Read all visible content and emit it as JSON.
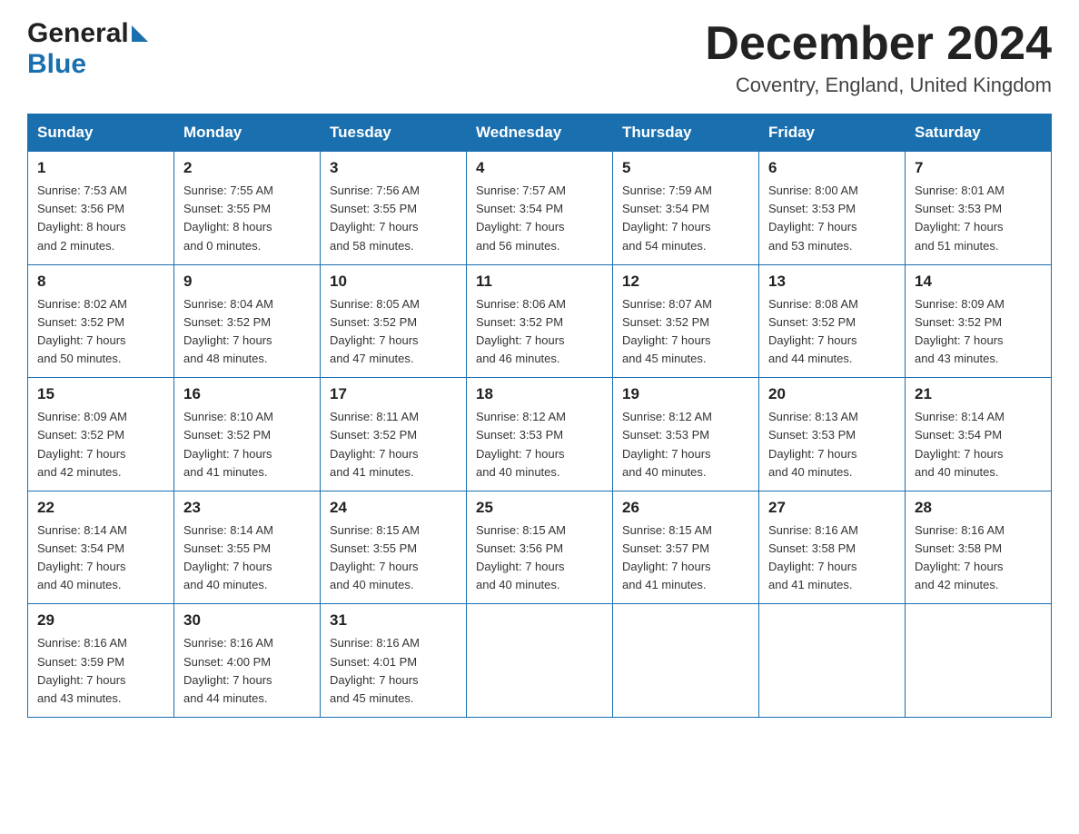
{
  "header": {
    "logo_general": "General",
    "logo_blue": "Blue",
    "title": "December 2024",
    "subtitle": "Coventry, England, United Kingdom"
  },
  "days_of_week": [
    "Sunday",
    "Monday",
    "Tuesday",
    "Wednesday",
    "Thursday",
    "Friday",
    "Saturday"
  ],
  "weeks": [
    [
      {
        "day": "1",
        "sunrise": "7:53 AM",
        "sunset": "3:56 PM",
        "daylight": "8 hours and 2 minutes."
      },
      {
        "day": "2",
        "sunrise": "7:55 AM",
        "sunset": "3:55 PM",
        "daylight": "8 hours and 0 minutes."
      },
      {
        "day": "3",
        "sunrise": "7:56 AM",
        "sunset": "3:55 PM",
        "daylight": "7 hours and 58 minutes."
      },
      {
        "day": "4",
        "sunrise": "7:57 AM",
        "sunset": "3:54 PM",
        "daylight": "7 hours and 56 minutes."
      },
      {
        "day": "5",
        "sunrise": "7:59 AM",
        "sunset": "3:54 PM",
        "daylight": "7 hours and 54 minutes."
      },
      {
        "day": "6",
        "sunrise": "8:00 AM",
        "sunset": "3:53 PM",
        "daylight": "7 hours and 53 minutes."
      },
      {
        "day": "7",
        "sunrise": "8:01 AM",
        "sunset": "3:53 PM",
        "daylight": "7 hours and 51 minutes."
      }
    ],
    [
      {
        "day": "8",
        "sunrise": "8:02 AM",
        "sunset": "3:52 PM",
        "daylight": "7 hours and 50 minutes."
      },
      {
        "day": "9",
        "sunrise": "8:04 AM",
        "sunset": "3:52 PM",
        "daylight": "7 hours and 48 minutes."
      },
      {
        "day": "10",
        "sunrise": "8:05 AM",
        "sunset": "3:52 PM",
        "daylight": "7 hours and 47 minutes."
      },
      {
        "day": "11",
        "sunrise": "8:06 AM",
        "sunset": "3:52 PM",
        "daylight": "7 hours and 46 minutes."
      },
      {
        "day": "12",
        "sunrise": "8:07 AM",
        "sunset": "3:52 PM",
        "daylight": "7 hours and 45 minutes."
      },
      {
        "day": "13",
        "sunrise": "8:08 AM",
        "sunset": "3:52 PM",
        "daylight": "7 hours and 44 minutes."
      },
      {
        "day": "14",
        "sunrise": "8:09 AM",
        "sunset": "3:52 PM",
        "daylight": "7 hours and 43 minutes."
      }
    ],
    [
      {
        "day": "15",
        "sunrise": "8:09 AM",
        "sunset": "3:52 PM",
        "daylight": "7 hours and 42 minutes."
      },
      {
        "day": "16",
        "sunrise": "8:10 AM",
        "sunset": "3:52 PM",
        "daylight": "7 hours and 41 minutes."
      },
      {
        "day": "17",
        "sunrise": "8:11 AM",
        "sunset": "3:52 PM",
        "daylight": "7 hours and 41 minutes."
      },
      {
        "day": "18",
        "sunrise": "8:12 AM",
        "sunset": "3:53 PM",
        "daylight": "7 hours and 40 minutes."
      },
      {
        "day": "19",
        "sunrise": "8:12 AM",
        "sunset": "3:53 PM",
        "daylight": "7 hours and 40 minutes."
      },
      {
        "day": "20",
        "sunrise": "8:13 AM",
        "sunset": "3:53 PM",
        "daylight": "7 hours and 40 minutes."
      },
      {
        "day": "21",
        "sunrise": "8:14 AM",
        "sunset": "3:54 PM",
        "daylight": "7 hours and 40 minutes."
      }
    ],
    [
      {
        "day": "22",
        "sunrise": "8:14 AM",
        "sunset": "3:54 PM",
        "daylight": "7 hours and 40 minutes."
      },
      {
        "day": "23",
        "sunrise": "8:14 AM",
        "sunset": "3:55 PM",
        "daylight": "7 hours and 40 minutes."
      },
      {
        "day": "24",
        "sunrise": "8:15 AM",
        "sunset": "3:55 PM",
        "daylight": "7 hours and 40 minutes."
      },
      {
        "day": "25",
        "sunrise": "8:15 AM",
        "sunset": "3:56 PM",
        "daylight": "7 hours and 40 minutes."
      },
      {
        "day": "26",
        "sunrise": "8:15 AM",
        "sunset": "3:57 PM",
        "daylight": "7 hours and 41 minutes."
      },
      {
        "day": "27",
        "sunrise": "8:16 AM",
        "sunset": "3:58 PM",
        "daylight": "7 hours and 41 minutes."
      },
      {
        "day": "28",
        "sunrise": "8:16 AM",
        "sunset": "3:58 PM",
        "daylight": "7 hours and 42 minutes."
      }
    ],
    [
      {
        "day": "29",
        "sunrise": "8:16 AM",
        "sunset": "3:59 PM",
        "daylight": "7 hours and 43 minutes."
      },
      {
        "day": "30",
        "sunrise": "8:16 AM",
        "sunset": "4:00 PM",
        "daylight": "7 hours and 44 minutes."
      },
      {
        "day": "31",
        "sunrise": "8:16 AM",
        "sunset": "4:01 PM",
        "daylight": "7 hours and 45 minutes."
      },
      null,
      null,
      null,
      null
    ]
  ],
  "labels": {
    "sunrise": "Sunrise:",
    "sunset": "Sunset:",
    "daylight": "Daylight:"
  }
}
